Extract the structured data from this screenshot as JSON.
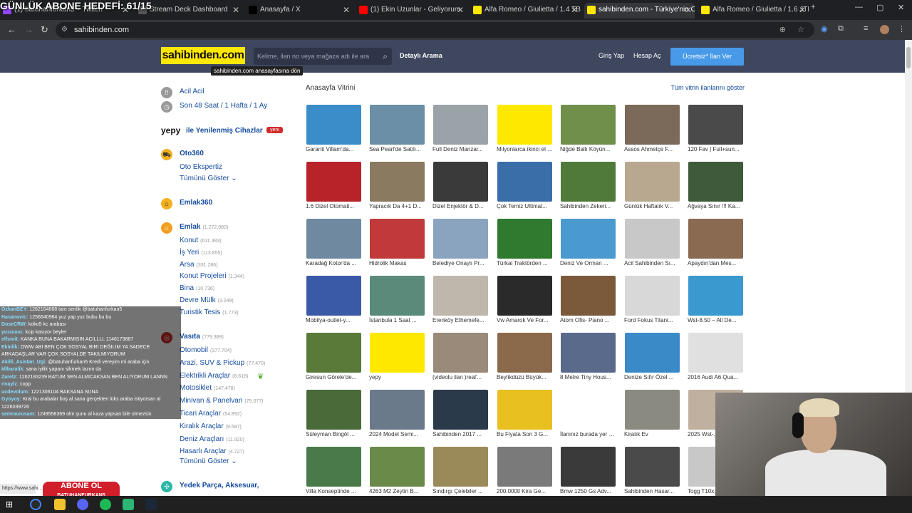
{
  "overlay": {
    "goal": "GÜNLÜK ABONE HEDEFİ: 61/15",
    "abone": "ABONE OL",
    "abone_sub": "BATUHANFURKAN5"
  },
  "tabs": [
    {
      "label": "(1) batuhanfurkan5 – Twitch",
      "color": "#9147ff",
      "active": false
    },
    {
      "label": "Stream Deck Dashboard",
      "color": "#555",
      "active": false
    },
    {
      "label": "Anasayfa / X",
      "color": "#000",
      "active": false
    },
    {
      "label": "(1) Ekin Uzunlar - Geliyorum",
      "color": "#f00",
      "active": false
    },
    {
      "label": "Alfa Romeo / Giulietta / 1.4 TB",
      "color": "#ffe800",
      "active": false
    },
    {
      "label": "sahibinden.com - Türkiye'nin O",
      "color": "#ffe800",
      "active": true
    },
    {
      "label": "Alfa Romeo / Giulietta / 1.6 JTD",
      "color": "#ffe800",
      "active": false
    }
  ],
  "browser": {
    "url": "sahibinden.com",
    "new_tab": "+"
  },
  "header": {
    "logo": "sahibinden.com",
    "search_placeholder": "Kelime, ilan no veya mağaza adı ile ara",
    "detailed_search": "Detaylı Arama",
    "login": "Giriş Yap",
    "signup": "Hesap Aç",
    "post_ad": "Ücretsiz* İlan Ver",
    "tooltip": "sahibinden.com anasayfasına dön"
  },
  "sidebar": {
    "urgent": "Acil Acil",
    "recent": {
      "a": "Son 48 Saat",
      "sep": " / ",
      "b": "1 Hafta",
      "c": "1 Ay"
    },
    "yepy": {
      "brand": "yepy",
      "label": "ile Yenilenmiş Cihazlar",
      "badge": "yeni"
    },
    "oto360": "Oto360",
    "oto_expert": "Oto Ekspertiz",
    "show_all": "Tümünü Göster",
    "emlak360": "Emlak360",
    "emlak": {
      "label": "Emlak",
      "count": "(1.272.080)"
    },
    "emlak_items": [
      {
        "label": "Konut",
        "count": "(611.383)"
      },
      {
        "label": "İş Yeri",
        "count": "(113.855)"
      },
      {
        "label": "Arsa",
        "count": "(331.286)"
      },
      {
        "label": "Konut Projeleri",
        "count": "(1.344)"
      },
      {
        "label": "Bina",
        "count": "(10.736)"
      },
      {
        "label": "Devre Mülk",
        "count": "(3.049)"
      },
      {
        "label": "Turistik Tesis",
        "count": "(1.773)"
      }
    ],
    "vasita": {
      "label": "Vasıta",
      "count": "(779.389)"
    },
    "vasita_items": [
      {
        "label": "Otomobil",
        "count": "(377.704)"
      },
      {
        "label": "Arazi, SUV & Pickup",
        "count": "(77.470)"
      },
      {
        "label": "Elektrikli Araçlar",
        "count": "(8.618)"
      },
      {
        "label": "Motosiklet",
        "count": "(147.478)"
      },
      {
        "label": "Minivan & Panelvan",
        "count": "(75.077)"
      },
      {
        "label": "Ticari Araçlar",
        "count": "(54.892)"
      },
      {
        "label": "Kiralık Araçlar",
        "count": "(9.687)"
      },
      {
        "label": "Deniz Araçları",
        "count": "(11.920)"
      },
      {
        "label": "Hasarlı Araçlar",
        "count": "(4.727)"
      }
    ],
    "show_all_2": "Tümünü Göster",
    "yedek": "Yedek Parça, Aksesuar,"
  },
  "main": {
    "title": "Anasayfa Vitrini",
    "all_link": "Tüm vitrin ilanlarını göster",
    "cards": [
      {
        "cap": "Garanti Villam'da...",
        "c": "#3a8dc8"
      },
      {
        "cap": "Sea Pearl'de Satılı...",
        "c": "#6a8fa6"
      },
      {
        "cap": "Full Deniz Manzar...",
        "c": "#9aa4a8"
      },
      {
        "cap": "Milyonlarca ikinci el ürün, her gün uygun fiyatlarla.",
        "c": "#ffe800"
      },
      {
        "cap": "Niğde Ballı Köyün...",
        "c": "#6f8f4a"
      },
      {
        "cap": "Assos Ahmetçe F...",
        "c": "#7b6a5a"
      },
      {
        "cap": "120 Fav | Full+sun...",
        "c": "#4a4a4a"
      },
      {
        "cap": "1.6 Dizel Otomati...",
        "c": "#b8232a"
      },
      {
        "cap": "Yapracık Da 4+1 D...",
        "c": "#8a7a60"
      },
      {
        "cap": "Dizel Enjektör & D...",
        "c": "#3a3a3a"
      },
      {
        "cap": "Çok Temiz Ultimat...",
        "c": "#3a6ea8"
      },
      {
        "cap": "Sahibinden Zekeri...",
        "c": "#4f7a3a"
      },
      {
        "cap": "Günlük Haftalık V...",
        "c": "#b8a890"
      },
      {
        "cap": "Ağvaya Sınır !!! Ka...",
        "c": "#3e5a3a"
      },
      {
        "cap": "Karadağ Kotor'da ...",
        "c": "#6f8aa0"
      },
      {
        "cap": "Hidrolik Makas",
        "c": "#c03a3a"
      },
      {
        "cap": "Belediye Onaylı Pr...",
        "c": "#8aa4c0"
      },
      {
        "cap": "Türkal Traktörden ...",
        "c": "#2f7a2f"
      },
      {
        "cap": "Deniz Ve Orman ...",
        "c": "#4a9ad0"
      },
      {
        "cap": "Acil Sahibinden Sı...",
        "c": "#c8c8c8"
      },
      {
        "cap": "Apaydın'dan Mes...",
        "c": "#8a6a50"
      },
      {
        "cap": "Mobilya-outlet-y...",
        "c": "#3a5aa8"
      },
      {
        "cap": "İstanbula 1 Saat ...",
        "c": "#5a8a7a"
      },
      {
        "cap": "Erenköy Ethemefe...",
        "c": "#bfb6ac"
      },
      {
        "cap": "Vw Amarok Ve For...",
        "c": "#2a2a2a"
      },
      {
        "cap": "Atom Ofis- Piano ...",
        "c": "#7a5a3a"
      },
      {
        "cap": "Ford Fokus Titani...",
        "c": "#d8d8d8"
      },
      {
        "cap": "Wst-8.50 – All De...",
        "c": "#3a9ad0"
      },
      {
        "cap": "Giresun Görele'de...",
        "c": "#5a7a3a"
      },
      {
        "cap": "yepy",
        "c": "#ffe800"
      },
      {
        "cap": "(videolu ilan )real'...",
        "c": "#9a8a7a"
      },
      {
        "cap": "Beylikdüzü Büyük...",
        "c": "#8a6a4a"
      },
      {
        "cap": "8 Metre Tiny Hous...",
        "c": "#5a6a8a"
      },
      {
        "cap": "Denize Sıfır Özel ...",
        "c": "#3a8ac8"
      },
      {
        "cap": "2016 Audi A6 Qua...",
        "c": "#e0e0e0"
      },
      {
        "cap": "Süleyman Bingöl ...",
        "c": "#4a6a3a"
      },
      {
        "cap": "2024 Model Semi...",
        "c": "#6a7a8a"
      },
      {
        "cap": "Sahibinden 2017 ...",
        "c": "#2a3a4a"
      },
      {
        "cap": "Bu Fiyata Son 3 G...",
        "c": "#e8c020"
      },
      {
        "cap": "İlanınız burada yer alsın",
        "c": "#ffffff"
      },
      {
        "cap": "Kiralık Ev",
        "c": "#8a8a80"
      },
      {
        "cap": "2025 Wst-...",
        "c": "#c0b0a0"
      },
      {
        "cap": "Villa Konseptinde ...",
        "c": "#4a7a4a"
      },
      {
        "cap": "4263 M2 Zeytin B...",
        "c": "#6a8a4a"
      },
      {
        "cap": "Sındırgı Çelebiler ...",
        "c": "#9a8a5a"
      },
      {
        "cap": "200.000tl Kira Ge...",
        "c": "#7a7a7a"
      },
      {
        "cap": "Bmw 1250 Gs Adv...",
        "c": "#3a3a3a"
      },
      {
        "cap": "Sahibinden Hasar...",
        "c": "#4a4a4a"
      },
      {
        "cap": "Togg T10x...",
        "c": "#c8c8c8"
      }
    ]
  },
  "chat": [
    {
      "u": "OzkanBEY:",
      "t": "1262164668 tam senlik @batuhanfurkan5"
    },
    {
      "u": "Hasanovic:",
      "t": "1256640964 yuz yap yuz bubu bu bu"
    },
    {
      "u": "DoseCRW:",
      "t": "koko5 kc arabası"
    },
    {
      "u": "yusuuuu:",
      "t": "kcip kasıyor beyler"
    },
    {
      "u": "elfsmit:",
      "t": "KANKA BUNA BAKARMISIN ACİLLLL 1146173887"
    },
    {
      "u": "Ekinlik:",
      "t": "OWW ABİ BEN ÇOK SOSYAL BİRİ DEĞİLİM YA SADECE"
    },
    {
      "u": "",
      "t": "ARKADAŞLAR VAR ÇOK SOSYALDE TAKILMIYORUM"
    },
    {
      "u": "Akilli_Asistan_Ugi:",
      "t": "@batuhanfurkan5 Kredi vereyim mi araba için"
    },
    {
      "u": "kllbaralik:",
      "t": "sana iyilik yapanı sikmek lazım da"
    },
    {
      "u": "Zaretz:",
      "t": "1262183239 BATUM SEN ALMICAKSAN BEN ALIYORUM LANNN"
    },
    {
      "u": "rivaylz:",
      "t": "copp"
    },
    {
      "u": "ucdevolum:",
      "t": "1221306104 BAKSANA SUNA"
    },
    {
      "u": "Gyoyoy:",
      "t": "Kral bu arabalar boş al sana gerçekten lüks araba istiyorsan al"
    },
    {
      "u": "",
      "t": "1226039726"
    },
    {
      "u": "semraurusam:",
      "t": "1249558369 olm şunu al kaza yapsan bile olmezsin"
    }
  ],
  "status": "https://www.sahi..."
}
